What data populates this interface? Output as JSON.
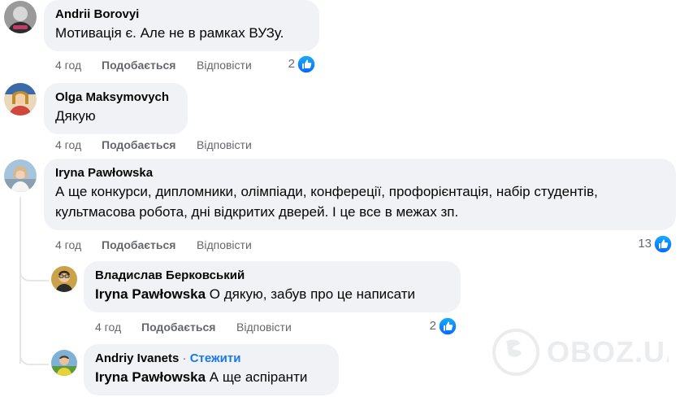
{
  "comments": [
    {
      "author": "Andrii Borovyi",
      "text": "Мотивація є. Але не в рамках ВУЗу.",
      "time": "4 год",
      "like_label": "Подобається",
      "reply_label": "Відповісти",
      "reactions": "2"
    },
    {
      "author": "Olga Maksymovych",
      "text": "Дякую",
      "time": "4 год",
      "like_label": "Подобається",
      "reply_label": "Відповісти"
    },
    {
      "author": "Iryna Pawłowska",
      "text_line1": "А ще конкурси, дипломники, олімпіади, конфереції, профорієнтація, набір студентів,",
      "text_line2": "культмасова робота, дні відкритих дверей. І це все в межах зп.",
      "time": "4 год",
      "like_label": "Подобається",
      "reply_label": "Відповісти",
      "reactions": "13"
    }
  ],
  "replies": [
    {
      "author": "Владислав Берковський",
      "mention": "Iryna Pawłowska",
      "text": " О дякую, забув про це написати",
      "time": "4 год",
      "like_label": "Подобається",
      "reply_label": "Відповісти",
      "reactions": "2"
    },
    {
      "author": "Andriy Ivanets",
      "separator": "·",
      "follow_label": "Стежити",
      "mention": "Iryna Pawłowska",
      "text": " А ще аспіранти"
    }
  ],
  "watermark": "OBOZ.UA",
  "colors": {
    "bubble": "#f0f2f5",
    "link_blue": "#1877f2",
    "meta_gray": "#65676b",
    "like_gradient_start": "#18aefa",
    "like_gradient_end": "#0866ff"
  }
}
